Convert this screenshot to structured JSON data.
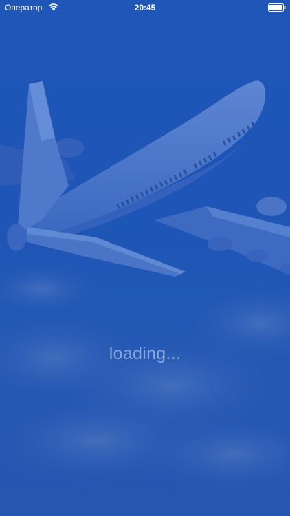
{
  "status_bar": {
    "carrier": "Оператор",
    "time": "20:45",
    "wifi_icon": "wifi-icon",
    "battery_icon": "battery-icon"
  },
  "splash": {
    "loading_text": "loading...",
    "background_color": "#1f56b8",
    "illustration": "airplane-icon"
  }
}
